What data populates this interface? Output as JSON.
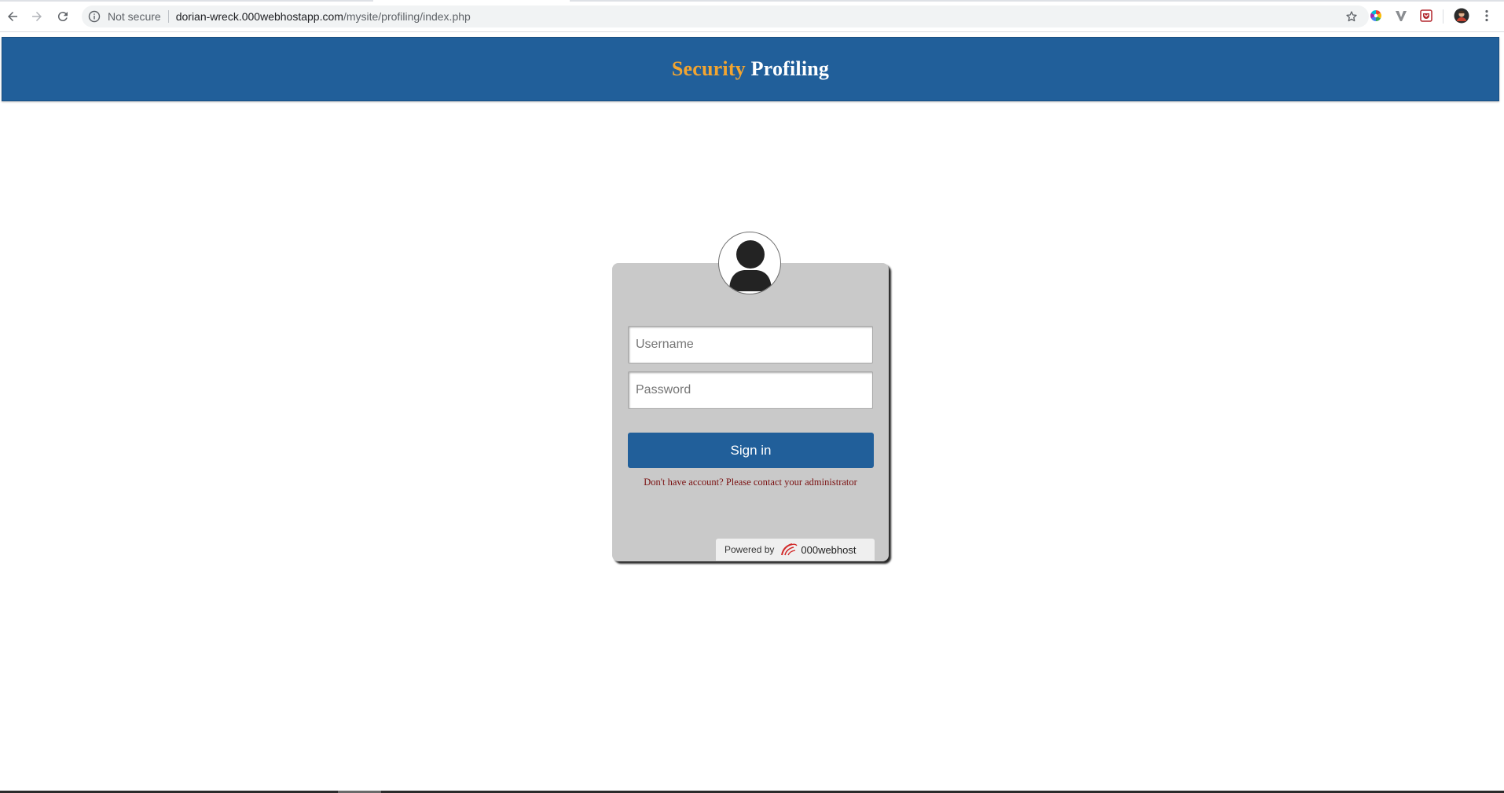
{
  "browser": {
    "security_label": "Not secure",
    "url_host": "dorian-wreck.000webhostapp.com",
    "url_path": "/mysite/profiling/index.php",
    "icons": [
      "back-arrow-icon",
      "forward-arrow-icon",
      "reload-icon",
      "info-icon",
      "star-icon",
      "color-wheel-extension-icon",
      "v-extension-icon",
      "pocket-extension-icon",
      "profile-avatar-icon",
      "kebab-menu-icon"
    ]
  },
  "header": {
    "title_word1": "Security",
    "title_word2": "Profiling",
    "background_color": "#215f9a",
    "accent_color": "#f3a530"
  },
  "login": {
    "username_placeholder": "Username",
    "password_placeholder": "Password",
    "signin_label": "Sign in",
    "help_text": "Don't have account? Please contact your administrator",
    "card_color": "#c9c9c9"
  },
  "footer_badge": {
    "powered_label": "Powered by",
    "brand_name": "000webhost"
  }
}
